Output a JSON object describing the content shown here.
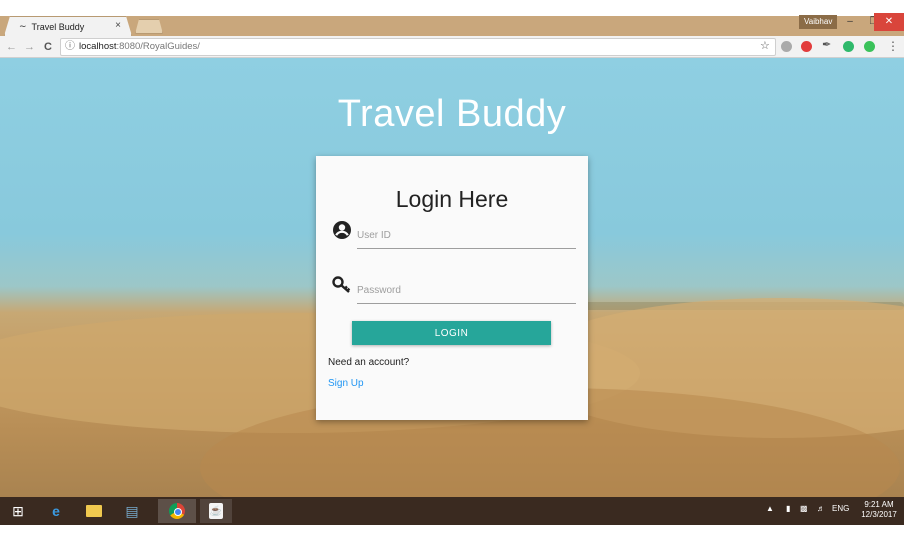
{
  "browser": {
    "tab_title": "Travel Buddy",
    "tab_icon": "wave-icon",
    "tab_close": "×",
    "user_badge": "Vaibhav",
    "window_controls": {
      "minimize": "–",
      "maximize": "❐",
      "close": "✕"
    },
    "url_host": "localhost",
    "url_rest": ":8080/RoyalGuides/"
  },
  "page": {
    "brand": "Travel Buddy",
    "login": {
      "title": "Login Here",
      "user_placeholder": "User ID",
      "password_placeholder": "Password",
      "button": "LOGIN",
      "need_account": "Need an account?",
      "signup": "Sign Up"
    },
    "colors": {
      "accent": "#26a69a",
      "link": "#2196f3",
      "sky": "#88c9dc",
      "sand": "#c39b63"
    }
  },
  "taskbar": {
    "apps": [
      "windows-start",
      "internet-explorer",
      "file-explorer",
      "network",
      "chrome",
      "java"
    ],
    "lang": "ENG",
    "time": "9:21 AM",
    "date": "12/3/2017"
  }
}
